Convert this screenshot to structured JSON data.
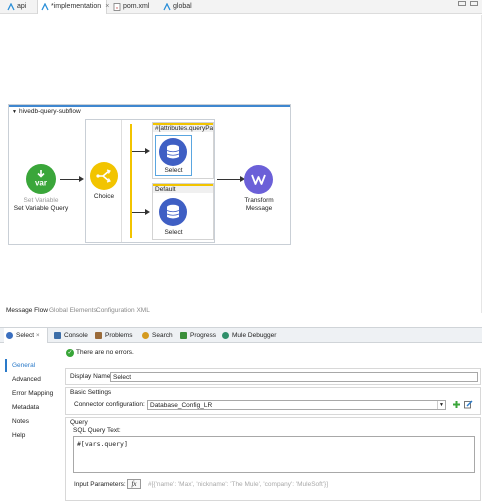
{
  "editor_tabs": [
    {
      "label": "api",
      "icon": "mule-icon"
    },
    {
      "label": "*implementation",
      "icon": "mule-icon",
      "close": "×"
    },
    {
      "label": "pom.xml",
      "icon": "xml-file-icon"
    },
    {
      "label": "global",
      "icon": "mule-icon"
    }
  ],
  "flow": {
    "name": "hivedb-query-subflow",
    "set_variable": {
      "badge": "var",
      "type": "Set Variable",
      "name": "Set Variable Query",
      "color": "#3aa63a"
    },
    "choice": {
      "name": "Choice",
      "color": "#f2c400"
    },
    "routes": [
      {
        "condition": "#[attributes.queryPara...",
        "processor": "Select"
      },
      {
        "condition": "Default",
        "processor": "Select"
      }
    ],
    "transform": {
      "name": "Transform",
      "name2": "Message",
      "color": "#6b60d8"
    }
  },
  "editor_sub_tabs": [
    "Message Flow",
    "Global Elements",
    "Configuration XML"
  ],
  "view_tabs": [
    {
      "label": "Select",
      "close": "×",
      "icon_color": "#3a6fbf"
    },
    {
      "label": "Console",
      "icon_color": "#3d6ea8"
    },
    {
      "label": "Problems",
      "icon_color": "#9a6b3a"
    },
    {
      "label": "Search",
      "icon_color": "#d49a1f"
    },
    {
      "label": "Progress",
      "icon_color": "#3a8f3a"
    },
    {
      "label": "Mule Debugger",
      "icon_color": "#2f8f6a"
    }
  ],
  "status": "There are no errors.",
  "side_nav": [
    "General",
    "Advanced",
    "Error Mapping",
    "Metadata",
    "Notes",
    "Help"
  ],
  "form": {
    "display_name_label": "Display Name:",
    "display_name_value": "Select",
    "basic_settings_title": "Basic Settings",
    "connector_config_label": "Connector configuration:",
    "connector_config_value": "Database_Config_LR",
    "query_title": "Query",
    "sql_label": "SQL Query Text:",
    "sql_value": "#[vars.query]",
    "input_params_label": "Input Parameters:",
    "fx": "fx",
    "input_params_placeholder": "#[{'name': 'Max', 'nickname': 'The Mule', 'company': 'MuleSoft'}]"
  }
}
